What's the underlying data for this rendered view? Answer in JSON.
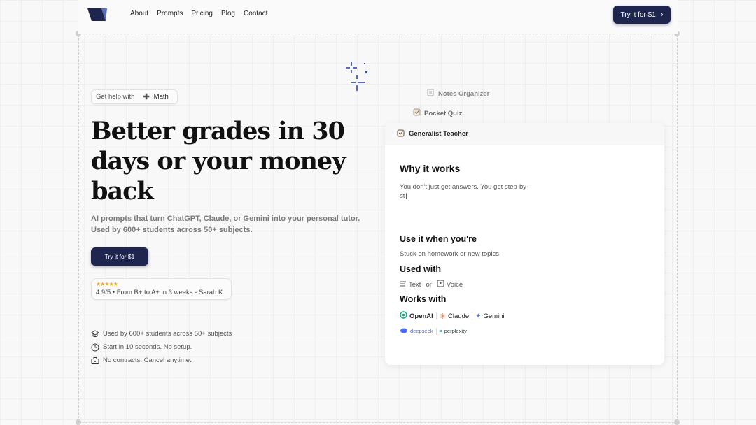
{
  "nav": {
    "links": [
      "About",
      "Prompts",
      "Pricing",
      "Blog",
      "Contact"
    ],
    "cta_label": "Try it for $1",
    "cta_arrow": "›"
  },
  "hero": {
    "pill_prefix": "Get help with",
    "pill_subject": "Math",
    "headline": "Better grades in 30 days or your money back",
    "subheadline": "AI prompts that turn ChatGPT, Claude, or Gemini into your personal tutor. Used by 600+ students across 50+ subjects.",
    "cta_label": "Try it for $1",
    "rating_stars": "★★★★★",
    "rating_text": "4.9/5 • From B+ to A+ in 3 weeks - Sarah K.",
    "features": [
      "Used by 600+ students across 50+ subjects",
      "Start in 10 seconds. No setup.",
      "No contracts. Cancel anytime."
    ]
  },
  "prompt_tabs": [
    "Notes Organizer",
    "Pocket Quiz",
    "Generalist Teacher"
  ],
  "card": {
    "why_title": "Why it works",
    "why_text_line1": "You don't just get answers. You get step-by-",
    "why_text_line2": "st",
    "use_title": "Use it when you're",
    "use_text": "Stuck on homework or new topics",
    "used_with_title": "Used with",
    "used_with_text": "Text",
    "used_with_or": "or",
    "used_with_voice": "Voice",
    "works_with_title": "Works with",
    "models_row1": [
      "OpenAI",
      "Claude",
      "Gemini"
    ],
    "models_row2": [
      "deepseek",
      "perplexity"
    ]
  },
  "colors": {
    "accent": "#1e2650",
    "star": "#f0a800",
    "sparkle": "#2f4aa8"
  }
}
